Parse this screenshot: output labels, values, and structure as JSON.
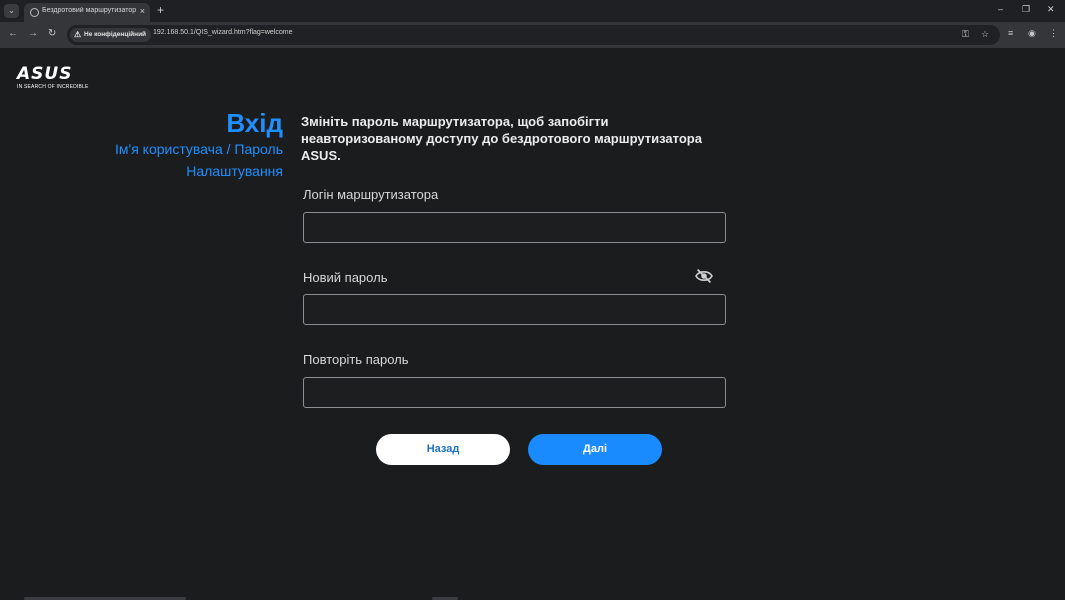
{
  "browser": {
    "tab_title": "Бездротовий маршрутизатор А",
    "tab_close": "×",
    "new_tab": "+",
    "url": "192.168.50.1/QIS_wizard.htm?flag=welcome",
    "security_label": "Не конфіденційний",
    "window_controls": {
      "minimize": "–",
      "restore": "❐",
      "close": "✕"
    }
  },
  "brand": {
    "logo": "ASUS",
    "tagline": "IN SEARCH OF INCREDIBLE"
  },
  "steps": {
    "title": "Вхід",
    "items": [
      "Ім'я користувача / Пароль",
      "Налаштування"
    ]
  },
  "form": {
    "heading": "Змініть пароль маршрутизатора, щоб запобігти неавторизованому доступу до бездротового маршрутизатора ASUS.",
    "login_label": "Логін маршрутизатора",
    "login_value": "",
    "password_label": "Новий пароль",
    "password_value": "",
    "confirm_label": "Повторіть пароль",
    "confirm_value": ""
  },
  "buttons": {
    "back": "Назад",
    "next": "Далі"
  },
  "colors": {
    "accent": "#1a8bff",
    "background": "#1b1c1e"
  }
}
